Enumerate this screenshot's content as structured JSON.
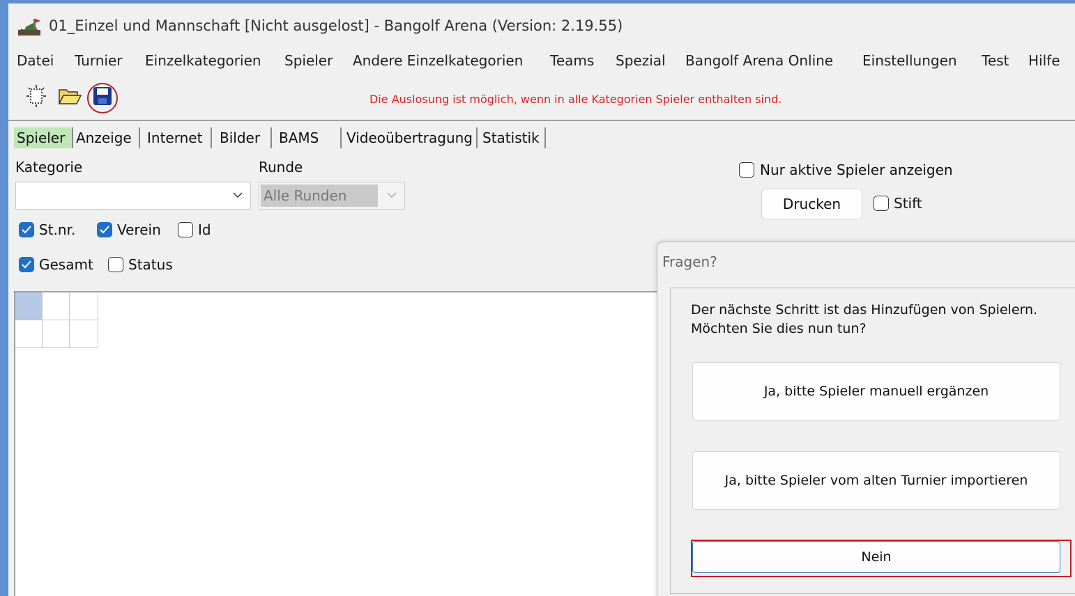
{
  "window": {
    "title": "01_Einzel und Mannschaft [Nicht ausgelost] - Bangolf Arena (Version: 2.19.55)"
  },
  "menu": {
    "items": [
      "Datei",
      "Turnier",
      "Einzelkategorien",
      "Spieler",
      "Andere Einzelkategorien",
      "Teams",
      "Spezial",
      "Bangolf Arena Online",
      "Einstellungen",
      "Test",
      "Hilfe"
    ]
  },
  "toolbar": {
    "icons": [
      "new-document-icon",
      "open-folder-icon",
      "save-disk-icon"
    ],
    "status_message": "Die Auslosung ist möglich, wenn in alle Kategorien Spieler enthalten sind.",
    "status_color": "#e02020"
  },
  "tabs": [
    "Spieler",
    "Anzeige",
    "Internet",
    "Bilder",
    "BAMS",
    "Videoübertragung",
    "Statistik"
  ],
  "active_tab": "Spieler",
  "filters": {
    "kategorie_label": "Kategorie",
    "kategorie_value": "",
    "runde_label": "Runde",
    "runde_value": "Alle Runden",
    "nur_aktive_label": "Nur aktive Spieler anzeigen",
    "nur_aktive_checked": false,
    "drucken_label": "Drucken",
    "stift_label": "Stift",
    "stift_checked": false
  },
  "columns": {
    "stnr_label": "St.nr.",
    "stnr_checked": true,
    "verein_label": "Verein",
    "verein_checked": true,
    "id_label": "Id",
    "id_checked": false,
    "gesamt_label": "Gesamt",
    "gesamt_checked": true,
    "status_label": "Status",
    "status_checked": false
  },
  "dialog": {
    "title": "Fragen?",
    "message_line1": "Der nächste Schritt ist das Hinzufügen von Spielern.",
    "message_line2": "Möchten Sie dies nun tun?",
    "button_manual": "Ja, bitte Spieler manuell ergänzen",
    "button_import": "Ja, bitte Spieler vom alten Turnier importieren",
    "button_no": "Nein"
  },
  "colors": {
    "active_tab_bg": "#bfe7b8",
    "checkbox_on": "#1f6fc9",
    "highlight_red": "#c0202a"
  }
}
